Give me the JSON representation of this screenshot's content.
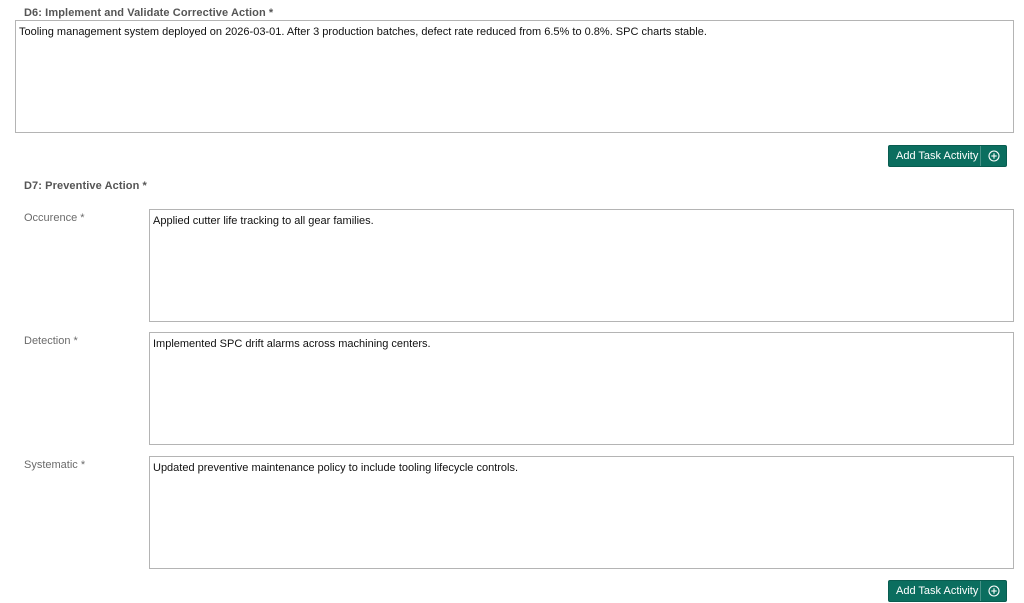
{
  "d6": {
    "title": "D6: Implement and Validate Corrective Action *",
    "value": "Tooling management system deployed on 2026-03-01. After 3 production batches, defect rate reduced from 6.5% to 0.8%. SPC charts stable.",
    "add_button_label": "Add Task Activity"
  },
  "d7": {
    "title": "D7: Preventive Action *",
    "fields": [
      {
        "label": "Occurence *",
        "value": "Applied cutter life tracking to all gear families."
      },
      {
        "label": "Detection *",
        "value": "Implemented SPC drift alarms across machining centers."
      },
      {
        "label": "Systematic *",
        "value": "Updated preventive maintenance policy to include tooling lifecycle controls."
      }
    ],
    "add_button_label": "Add Task Activity"
  },
  "icons": {
    "add": "plus-circle-icon"
  },
  "colors": {
    "button_bg": "#0b6e5f",
    "label_gray": "#6b6b6b",
    "title_gray": "#555555"
  }
}
